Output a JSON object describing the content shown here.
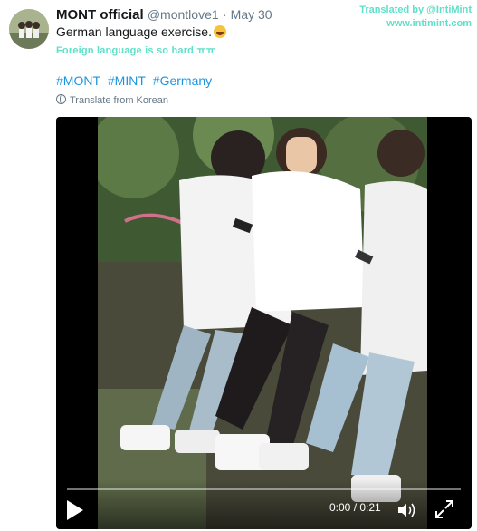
{
  "tweet": {
    "display_name": "MONT official",
    "handle": "@montlove1",
    "separator": "·",
    "date": "May 30",
    "text": "German language exercise.",
    "emoji": "grinning-face-emoji",
    "translation_overlay": "Foreign language is so hard ㅠㅠ",
    "hashtags": [
      "#MONT",
      "#MINT",
      "#Germany"
    ],
    "translate_label": "Translate from Korean"
  },
  "credit": {
    "line1": "Translated by @IntiMint",
    "line2": "www.intimint.com"
  },
  "video": {
    "time": "0:00 / 0:21",
    "progress": 0,
    "play_icon": "play-icon",
    "volume_icon": "volume-icon",
    "fullscreen_icon": "fullscreen-icon"
  },
  "colors": {
    "link": "#1b95e0",
    "secondary_text": "#657786",
    "overlay_text": "#5fe0c8"
  }
}
